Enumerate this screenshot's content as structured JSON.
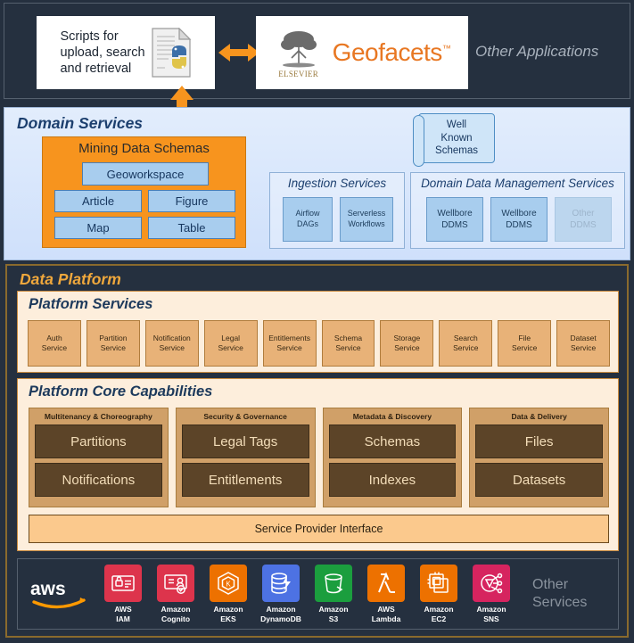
{
  "top_band": {
    "scripts_card": {
      "label": "Scripts for\nupload, search\nand retrieval",
      "line1": "Scripts for",
      "line2": "upload, search",
      "line3": "and retrieval",
      "icon": "python-document-icon"
    },
    "geofacets_card": {
      "brand": "Geofacets",
      "tm": "™",
      "publisher": "ELSEVIER",
      "logo_icon": "elsevier-tree-icon"
    },
    "other_applications": "Other Applications",
    "arrow_horizontal": "bidirectional-arrow",
    "arrow_vertical": "up-arrow",
    "arrow_color": "#f7941e"
  },
  "domain_services": {
    "title": "Domain Services",
    "mining": {
      "title": "Mining Data Schemas",
      "geoworkspace": "Geoworkspace",
      "items": [
        "Article",
        "Figure",
        "Map",
        "Table"
      ]
    },
    "well_known_schemas": {
      "line1": "Well",
      "line2": "Known",
      "line3": "Schemas",
      "icon": "scroll-icon"
    },
    "ingestion": {
      "title": "Ingestion Services",
      "items": [
        {
          "line1": "Airflow",
          "line2": "DAGs"
        },
        {
          "line1": "Serverless",
          "line2": "Workflows"
        }
      ]
    },
    "ddms": {
      "title": "Domain Data Management Services",
      "items": [
        {
          "line1": "Wellbore",
          "line2": "DDMS",
          "muted": false
        },
        {
          "line1": "Wellbore",
          "line2": "DDMS",
          "muted": false
        },
        {
          "line1": "Other",
          "line2": "DDMS",
          "muted": true
        }
      ]
    }
  },
  "data_platform": {
    "title": "Data Platform",
    "platform_services": {
      "title": "Platform Services",
      "tiles": [
        {
          "line1": "Auth",
          "line2": "Service"
        },
        {
          "line1": "Partition",
          "line2": "Service"
        },
        {
          "line1": "Notification",
          "line2": "Service"
        },
        {
          "line1": "Legal",
          "line2": "Service"
        },
        {
          "line1": "Entitlements",
          "line2": "Service"
        },
        {
          "line1": "Schema",
          "line2": "Service"
        },
        {
          "line1": "Storage",
          "line2": "Service"
        },
        {
          "line1": "Search",
          "line2": "Service"
        },
        {
          "line1": "File",
          "line2": "Service"
        },
        {
          "line1": "Dataset",
          "line2": "Service"
        }
      ]
    },
    "core_capabilities": {
      "title": "Platform Core Capabilities",
      "groups": [
        {
          "title": "Multitenancy & Choreography",
          "items": [
            "Partitions",
            "Notifications"
          ]
        },
        {
          "title": "Security & Governance",
          "items": [
            "Legal Tags",
            "Entitlements"
          ]
        },
        {
          "title": "Metadata & Discovery",
          "items": [
            "Schemas",
            "Indexes"
          ]
        },
        {
          "title": "Data & Delivery",
          "items": [
            "Files",
            "Datasets"
          ]
        }
      ],
      "service_provider_interface": "Service Provider Interface"
    },
    "aws": {
      "logo": "aws",
      "services": [
        {
          "line1": "AWS",
          "line2": "IAM",
          "color": "#dd344c",
          "icon": "iam-icon"
        },
        {
          "line1": "Amazon",
          "line2": "Cognito",
          "color": "#dd344c",
          "icon": "cognito-icon"
        },
        {
          "line1": "Amazon",
          "line2": "EKS",
          "color": "#ed7100",
          "icon": "eks-icon"
        },
        {
          "line1": "Amazon",
          "line2": "DynamoDB",
          "color": "#4d72e3",
          "icon": "dynamodb-icon"
        },
        {
          "line1": "Amazon",
          "line2": "S3",
          "color": "#1b9e3e",
          "icon": "s3-icon"
        },
        {
          "line1": "AWS",
          "line2": "Lambda",
          "color": "#ed7100",
          "icon": "lambda-icon"
        },
        {
          "line1": "Amazon",
          "line2": "EC2",
          "color": "#ed7100",
          "icon": "ec2-icon"
        },
        {
          "line1": "Amazon",
          "line2": "SNS",
          "color": "#d6245f",
          "icon": "sns-icon"
        }
      ],
      "other_services_line1": "Other",
      "other_services_line2": "Services"
    }
  },
  "colors": {
    "background": "#25303f",
    "domain_bg": "#dbe9fc",
    "accent_orange": "#f7941e",
    "platform_border": "#8a6a2d",
    "panel_cream": "#fdeedc",
    "tile_tan": "#e8b278",
    "core_group_tan": "#d0a068",
    "core_tile_brown": "#5c4428",
    "geofacets_orange": "#e87722",
    "blue_box": "#a8cdee"
  }
}
